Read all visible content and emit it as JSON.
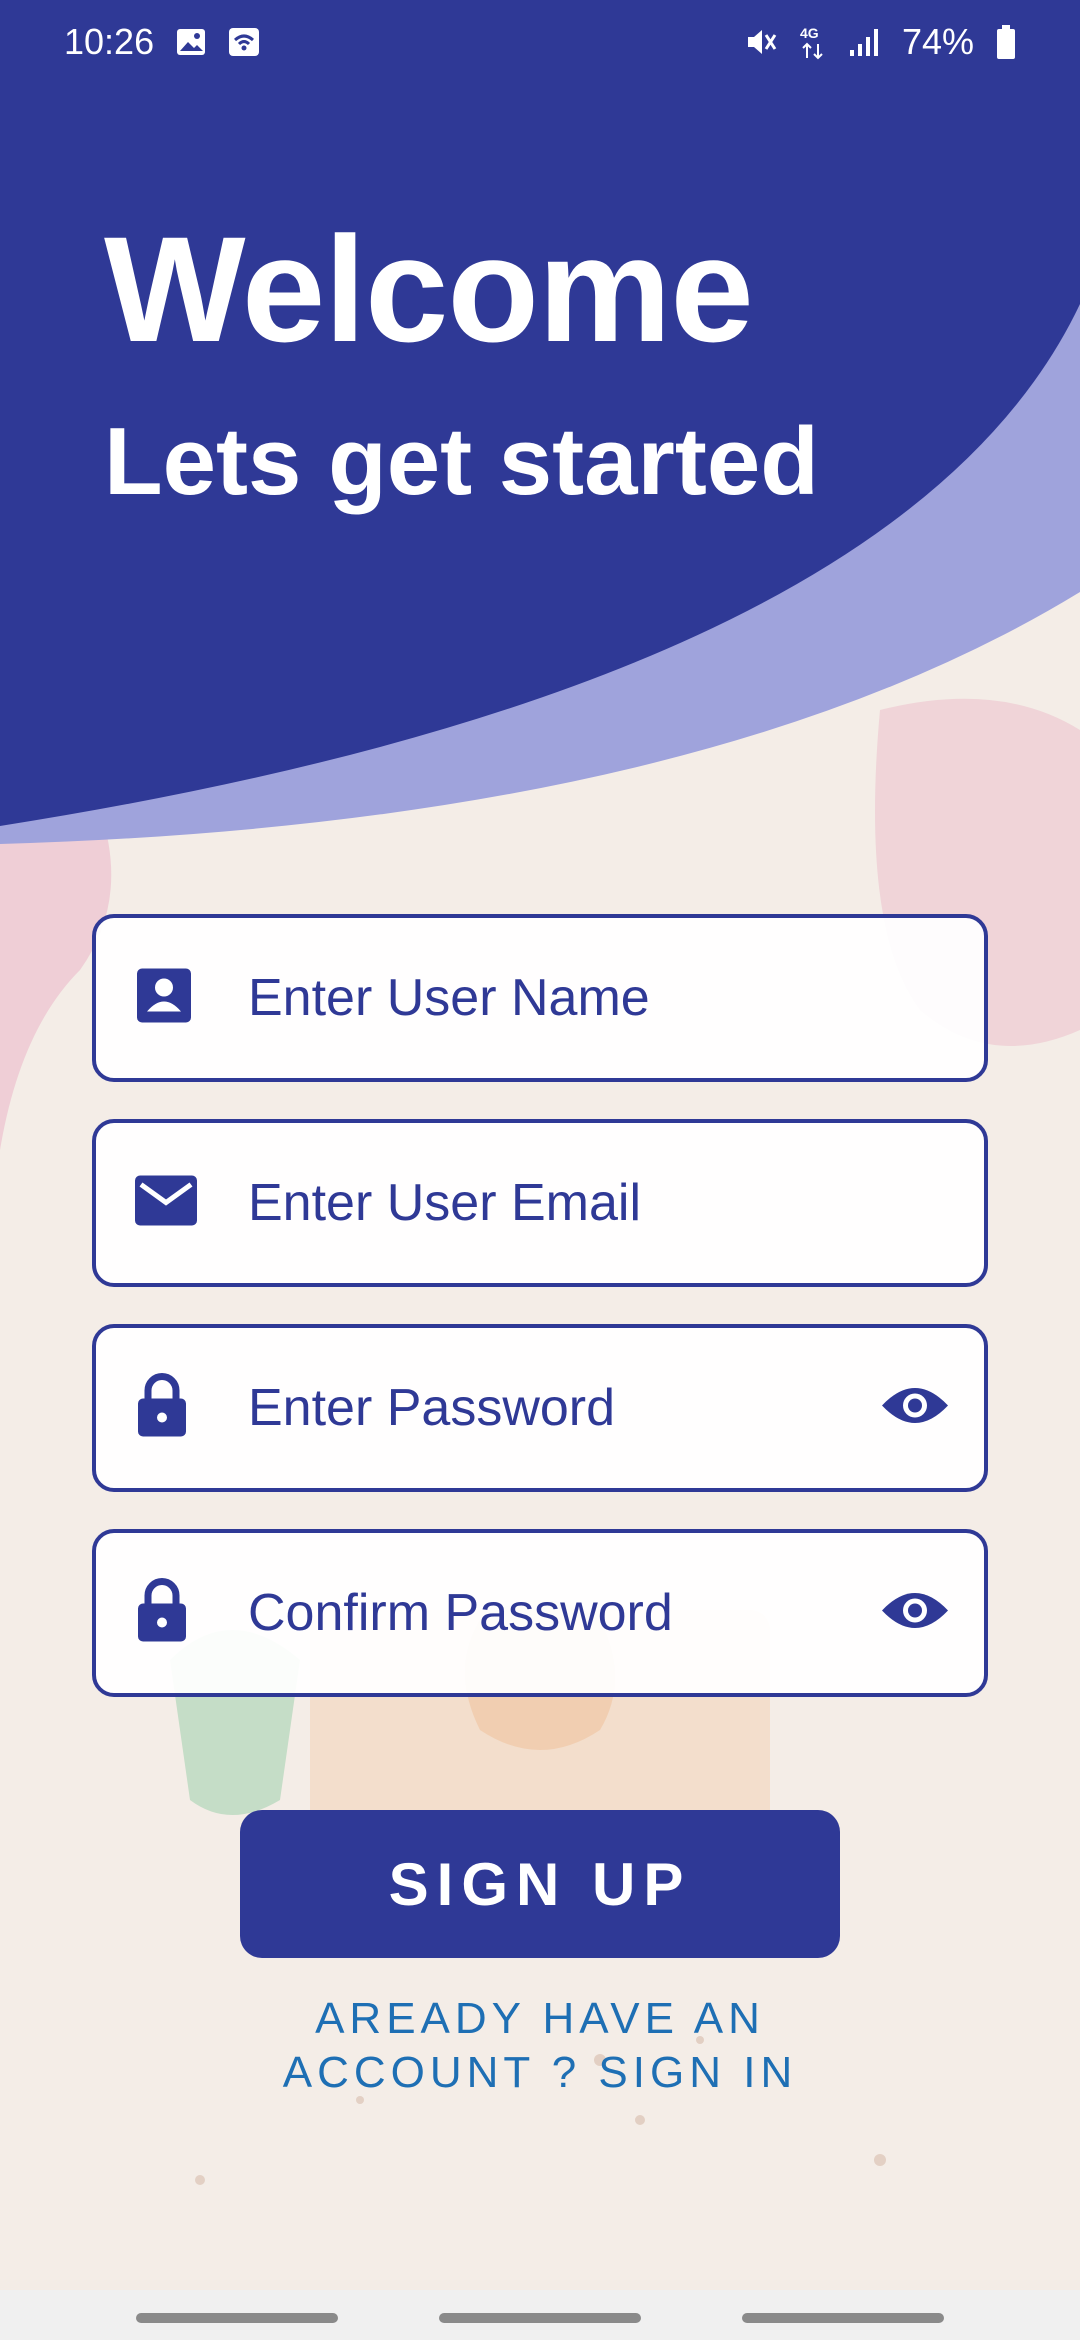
{
  "status_bar": {
    "time": "10:26",
    "battery": "74%",
    "icons": [
      "image-icon",
      "wifi-hotspot-icon",
      "mute-icon",
      "4g-icon",
      "signal-icon",
      "battery-icon"
    ]
  },
  "header": {
    "title": "Welcome",
    "subtitle": "Lets get started"
  },
  "form": {
    "username_placeholder": "Enter User Name",
    "email_placeholder": "Enter User Email",
    "password_placeholder": "Enter Password",
    "confirm_placeholder": "Confirm Password",
    "username_value": "",
    "email_value": "",
    "password_value": "",
    "confirm_value": ""
  },
  "actions": {
    "signup_label": "SIGN UP",
    "signin_line1": "AREADY HAVE AN",
    "signin_line2": "ACCOUNT ? SIGN IN"
  },
  "colors": {
    "primary": "#2f3996",
    "accent_light": "#9fa3dc",
    "link": "#1e6fb4",
    "white": "#ffffff"
  }
}
